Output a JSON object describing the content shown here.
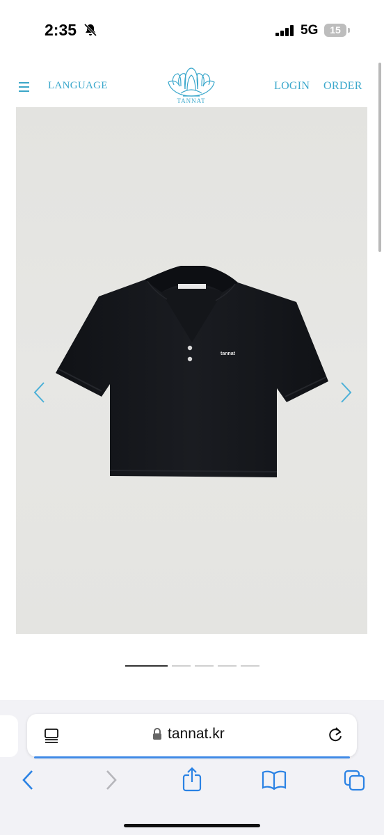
{
  "status_bar": {
    "time": "2:35",
    "network": "5G",
    "battery": "15"
  },
  "header": {
    "language_label": "LANGUAGE",
    "logo_text": "TANNAT",
    "login_label": "LOGIN",
    "order_label": "ORDER"
  },
  "product_image": {
    "label_text": "tannat",
    "slides_total": 5,
    "active_slide": 1
  },
  "browser": {
    "url": "tannat.kr"
  },
  "colors": {
    "accent": "#3ba8cc",
    "shirt": "#15171b",
    "background": "#e4e4e1"
  },
  "icons": [
    "menu-icon",
    "bell-slash-icon",
    "signal-icon",
    "battery-icon",
    "chevron-left-icon",
    "chevron-right-icon",
    "tabs-icon",
    "lock-icon",
    "reload-icon",
    "back-icon",
    "forward-icon",
    "share-icon",
    "bookmarks-icon",
    "tabs-overview-icon"
  ]
}
